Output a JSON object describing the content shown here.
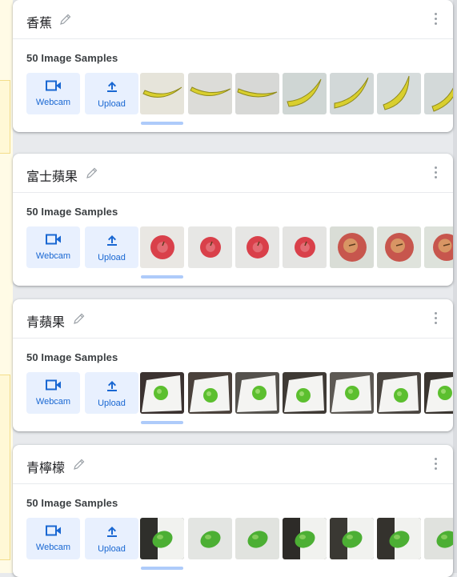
{
  "source_buttons": {
    "webcam": "Webcam",
    "upload": "Upload"
  },
  "classes": [
    {
      "name": "香蕉",
      "samples_label": "50 Image Samples",
      "fruit": "banana",
      "thumb_bg": [
        "#e6e4da",
        "#dcdcd8",
        "#d7d8d6",
        "#cfd6d4",
        "#d2d8d8",
        "#d6dcdc",
        "#d3d9d9"
      ]
    },
    {
      "name": "富士蘋果",
      "samples_label": "50 Image Samples",
      "fruit": "red-apple",
      "thumb_bg": [
        "#e9e7e3",
        "#e7e7e5",
        "#e6e6e4",
        "#e4e4e2",
        "#d9ddd6",
        "#dfe3dc",
        "#dde2db"
      ]
    },
    {
      "name": "青蘋果",
      "samples_label": "50 Image Samples",
      "fruit": "green-apple",
      "thumb_bg": [
        "#3b3230",
        "#4a413b",
        "#55524d",
        "#3f3a35",
        "#5d5954",
        "#4a4540",
        "#3a3530"
      ]
    },
    {
      "name": "青檸檬",
      "samples_label": "50 Image Samples",
      "fruit": "green-lemon",
      "thumb_bg": [
        "#2f2f2b",
        "#e3e5e2",
        "#e1e3df",
        "#2d2b28",
        "#3a3833",
        "#34322d",
        "#e0e2de"
      ]
    }
  ],
  "colors": {
    "accent": "#1967d2",
    "button_bg": "#e8f0fe",
    "scroll_indicator": "#aecbfa"
  }
}
